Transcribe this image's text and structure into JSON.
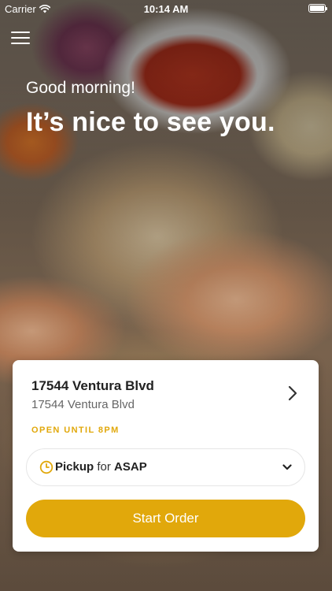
{
  "status_bar": {
    "carrier": "Carrier",
    "time": "10:14 AM",
    "battery_level": 1.0
  },
  "header": {
    "menu_icon": "hamburger-menu-icon",
    "greeting": "Good morning!",
    "headline": "It’s nice to see you."
  },
  "location": {
    "name": "17544 Ventura Blvd",
    "address": "17544 Ventura Blvd",
    "status": "OPEN UNTIL 8PM",
    "chevron_icon": "chevron-right-icon"
  },
  "order_type": {
    "icon": "clock-icon",
    "mode": "Pickup",
    "connector": "for",
    "time": "ASAP",
    "dropdown_icon": "chevron-down-icon"
  },
  "actions": {
    "start_order_label": "Start Order"
  },
  "colors": {
    "accent": "#e1a80b",
    "card_background": "#ffffff",
    "text_primary": "#222222",
    "text_secondary": "#666666"
  }
}
